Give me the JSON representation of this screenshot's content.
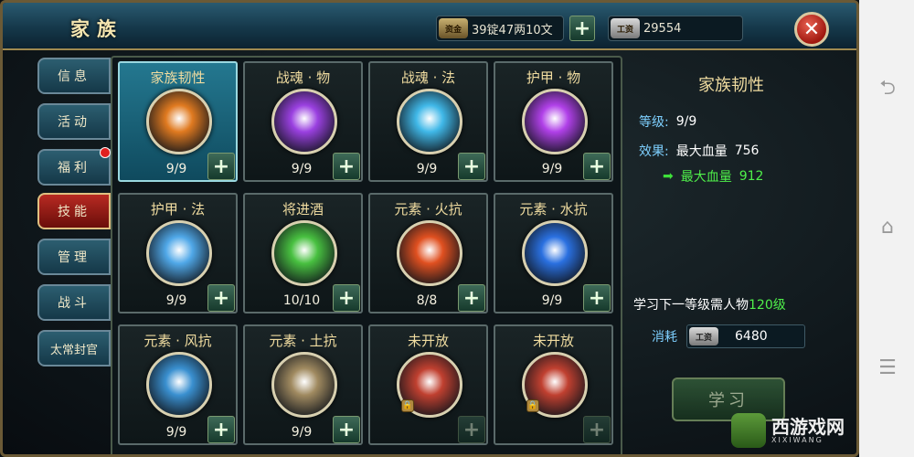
{
  "header": {
    "title": "家族",
    "currency_gold_icon": "资金",
    "currency_gold": "39锭47两10文",
    "currency_gong_icon": "工资",
    "currency_gong": "29554",
    "plus": "+",
    "close": "✕"
  },
  "sidebar": {
    "items": [
      {
        "label": "信息"
      },
      {
        "label": "活动"
      },
      {
        "label": "福利"
      },
      {
        "label": "技能"
      },
      {
        "label": "管理"
      },
      {
        "label": "战斗"
      },
      {
        "label": "太常封官"
      }
    ]
  },
  "skills": [
    {
      "name": "家族韧性",
      "level": "9/9",
      "color": "#e07a20"
    },
    {
      "name": "战魂 · 物",
      "level": "9/9",
      "color": "#9a40e0"
    },
    {
      "name": "战魂 · 法",
      "level": "9/9",
      "color": "#40b8e8"
    },
    {
      "name": "护甲 · 物",
      "level": "9/9",
      "color": "#b040e8"
    },
    {
      "name": "护甲 · 法",
      "level": "9/9",
      "color": "#50a8e8"
    },
    {
      "name": "将进酒",
      "level": "10/10",
      "color": "#48c040"
    },
    {
      "name": "元素 · 火抗",
      "level": "8/8",
      "color": "#e05020"
    },
    {
      "name": "元素 · 水抗",
      "level": "9/9",
      "color": "#2a70e0"
    },
    {
      "name": "元素 · 风抗",
      "level": "9/9",
      "color": "#3a90d0"
    },
    {
      "name": "元素 · 土抗",
      "level": "9/9",
      "color": "#a08a60"
    },
    {
      "name": "未开放",
      "level": "",
      "color": "#c04030"
    },
    {
      "name": "未开放",
      "level": "",
      "color": "#c04030"
    }
  ],
  "detail": {
    "title": "家族韧性",
    "level_label": "等级:",
    "level_value": "9/9",
    "effect_label": "效果:",
    "effect_stat": "最大血量",
    "effect_value": "756",
    "next_stat": "最大血量",
    "next_value": "912",
    "req_text": "学习下一等级需人物",
    "req_level": "120级",
    "cost_label": "消耗",
    "cost_icon": "工资",
    "cost_value": "6480",
    "learn_button": "学习"
  },
  "watermark": {
    "text": "西游戏网",
    "sub": "XIXIWANG"
  },
  "navbar": {
    "back": "⮌",
    "home": "⌂",
    "menu": "☰"
  }
}
